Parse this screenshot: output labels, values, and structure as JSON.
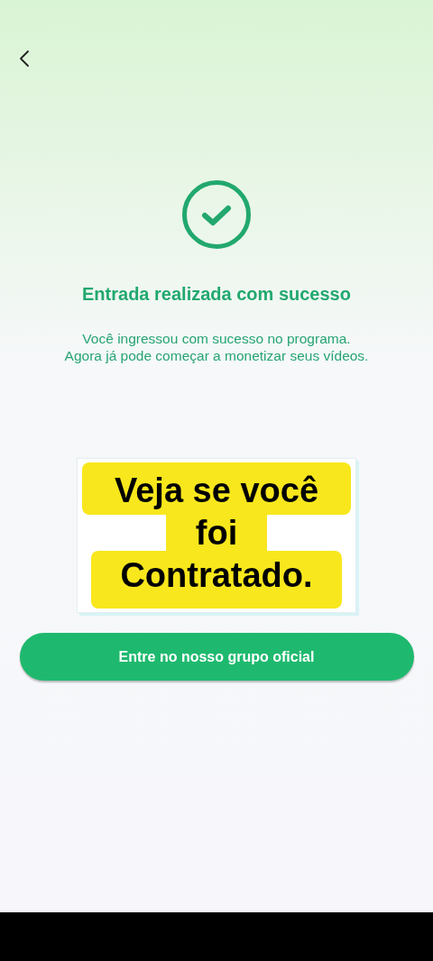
{
  "header": {
    "back": true
  },
  "status": {
    "title": "Entrada realizada com sucesso",
    "message": [
      "Você ingressou com sucesso no programa.",
      "Agora já pode começar a monetizar seus vídeos."
    ]
  },
  "sticker": {
    "lines": [
      "Veja se você",
      "foi",
      "Contratado."
    ]
  },
  "button": {
    "label": "Entre no nosso grupo oficial"
  }
}
